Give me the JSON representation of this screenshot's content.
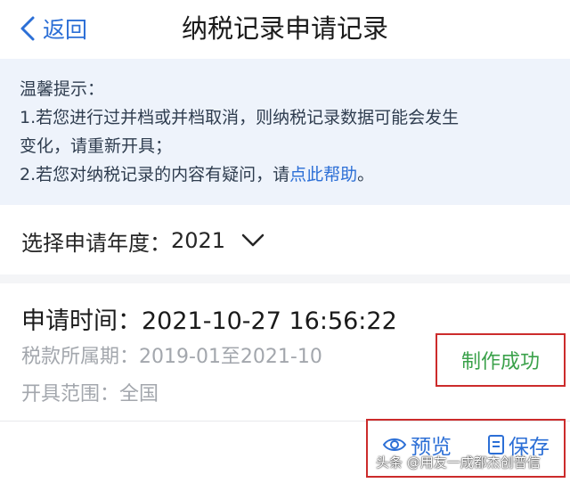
{
  "nav": {
    "back_label": "返回",
    "title": "纳税记录申请记录"
  },
  "tips": {
    "heading": "温馨提示：",
    "line1": "1.若您进行过并档或并档取消，则纳税记录数据可能会发生",
    "line2": "变化，请重新开具；",
    "line3_prefix": "2.若您对纳税记录的内容有疑问，请",
    "line3_link": "点此帮助",
    "line3_suffix": "。"
  },
  "year_filter": {
    "label": "选择申请年度：",
    "value": "2021"
  },
  "record": {
    "apply_time_label": "申请时间：",
    "apply_time_value": "2021-10-27 16:56:22",
    "period_label": "税款所属期：",
    "period_value": "2019-01至2021-10",
    "scope_label": "开具范围：",
    "scope_value": "全国",
    "status": "制作成功",
    "preview_label": "预览",
    "save_label": "保存"
  },
  "watermark": "头条 @用友一成都杰创普信",
  "colors": {
    "accent": "#2c6fd6",
    "success": "#3aa14a",
    "highlight_border": "#cc2b2b",
    "tips_bg": "#eef3fb"
  },
  "icons": {
    "back": "chevron-left-icon",
    "year_dropdown": "chevron-down-icon",
    "preview": "eye-icon",
    "save": "document-icon"
  }
}
